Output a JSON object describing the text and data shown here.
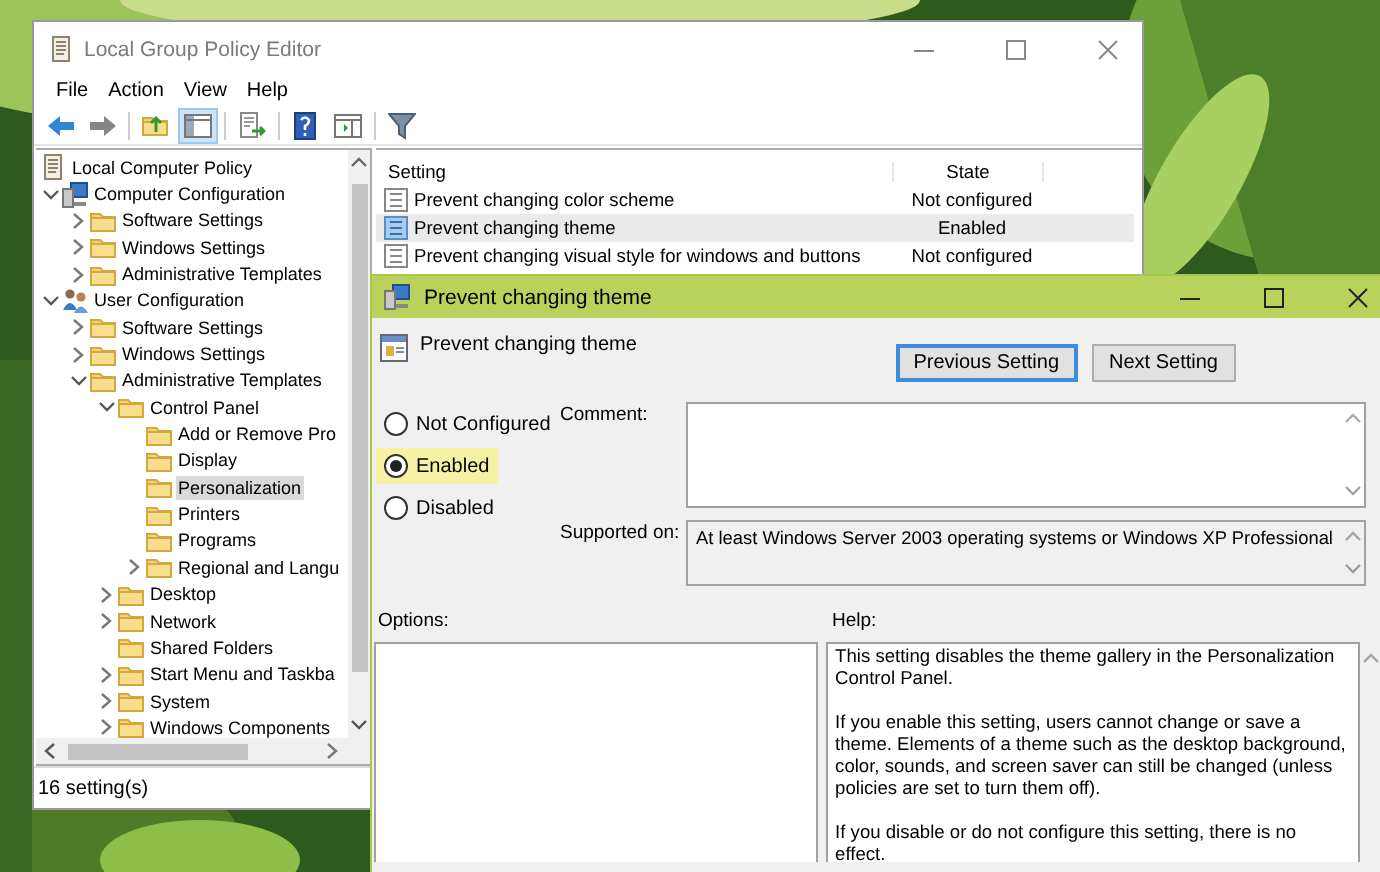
{
  "window": {
    "title": "Local Group Policy Editor",
    "menu": [
      "File",
      "Action",
      "View",
      "Help"
    ],
    "toolbar": [
      {
        "kind": "back",
        "disabled": false,
        "selected": false
      },
      {
        "kind": "forward",
        "disabled": true,
        "selected": false
      },
      {
        "kind": "separator"
      },
      {
        "kind": "up",
        "disabled": false,
        "selected": false
      },
      {
        "kind": "tree",
        "disabled": false,
        "selected": true
      },
      {
        "kind": "separator"
      },
      {
        "kind": "export",
        "disabled": false,
        "selected": false
      },
      {
        "kind": "separator"
      },
      {
        "kind": "help",
        "disabled": false,
        "selected": false
      },
      {
        "kind": "pane",
        "disabled": false,
        "selected": false
      },
      {
        "kind": "separator"
      },
      {
        "kind": "filter",
        "disabled": false,
        "selected": false
      }
    ]
  },
  "tree": [
    {
      "label": "Local Computer Policy",
      "kind": "policy",
      "selected": false,
      "children": [
        {
          "label": "Computer Configuration",
          "kind": "computer",
          "expanded": true,
          "selected": false,
          "children": [
            {
              "label": "Software Settings",
              "kind": "folder",
              "expanded": false,
              "selected": false
            },
            {
              "label": "Windows Settings",
              "kind": "folder",
              "expanded": false,
              "selected": false
            },
            {
              "label": "Administrative Templates",
              "kind": "folder",
              "expanded": false,
              "selected": false
            }
          ]
        },
        {
          "label": "User Configuration",
          "kind": "users",
          "expanded": true,
          "selected": false,
          "children": [
            {
              "label": "Software Settings",
              "kind": "folder",
              "expanded": false,
              "selected": false
            },
            {
              "label": "Windows Settings",
              "kind": "folder",
              "expanded": false,
              "selected": false
            },
            {
              "label": "Administrative Templates",
              "kind": "folder",
              "expanded": true,
              "selected": false,
              "children": [
                {
                  "label": "Control Panel",
                  "kind": "folder",
                  "expanded": true,
                  "selected": false,
                  "children": [
                    {
                      "label": "Add or Remove Pro",
                      "kind": "folder",
                      "selected": false
                    },
                    {
                      "label": "Display",
                      "kind": "folder",
                      "selected": false
                    },
                    {
                      "label": "Personalization",
                      "kind": "folder",
                      "selected": true
                    },
                    {
                      "label": "Printers",
                      "kind": "folder",
                      "selected": false
                    },
                    {
                      "label": "Programs",
                      "kind": "folder",
                      "selected": false
                    },
                    {
                      "label": "Regional and Langu",
                      "kind": "folder",
                      "expanded": false,
                      "selected": false
                    }
                  ]
                },
                {
                  "label": "Desktop",
                  "kind": "folder",
                  "expanded": false,
                  "selected": false
                },
                {
                  "label": "Network",
                  "kind": "folder",
                  "expanded": false,
                  "selected": false
                },
                {
                  "label": "Shared Folders",
                  "kind": "folder",
                  "selected": false
                },
                {
                  "label": "Start Menu and Taskba",
                  "kind": "folder",
                  "expanded": false,
                  "selected": false
                },
                {
                  "label": "System",
                  "kind": "folder",
                  "expanded": false,
                  "selected": false
                },
                {
                  "label": "Windows Components",
                  "kind": "folder",
                  "expanded": false,
                  "selected": false
                }
              ]
            }
          ]
        }
      ]
    }
  ],
  "table": {
    "columns": [
      "Setting",
      "State"
    ],
    "rows": [
      {
        "name": "Prevent changing color scheme",
        "state": "Not configured",
        "selected": false
      },
      {
        "name": "Prevent changing theme",
        "state": "Enabled",
        "selected": true
      },
      {
        "name": "Prevent changing visual style for windows and buttons",
        "state": "Not configured",
        "selected": false
      }
    ]
  },
  "status_bar": "16 setting(s)",
  "dialog": {
    "title": "Prevent changing theme",
    "setting_title": "Prevent changing theme",
    "buttons": [
      {
        "label": "Previous Setting",
        "focused": true
      },
      {
        "label": "Next Setting",
        "focused": false
      }
    ],
    "radios": [
      {
        "label": "Not Configured",
        "selected": false
      },
      {
        "label": "Enabled",
        "selected": true
      },
      {
        "label": "Disabled",
        "selected": false
      }
    ],
    "comment_label": "Comment:",
    "supported_label": "Supported on:",
    "supported_value": "At least Windows Server 2003 operating systems or Windows XP Professional",
    "options_label": "Options:",
    "help_label": "Help:",
    "help": [
      "This setting disables the theme gallery in the Personalization Control Panel.",
      "If you enable this setting, users cannot change or save a theme. Elements of a theme such as the desktop background, color, sounds, and screen saver can still be changed (unless policies are set to turn them off).",
      "If you disable or do not configure this setting, there is no effect."
    ]
  }
}
